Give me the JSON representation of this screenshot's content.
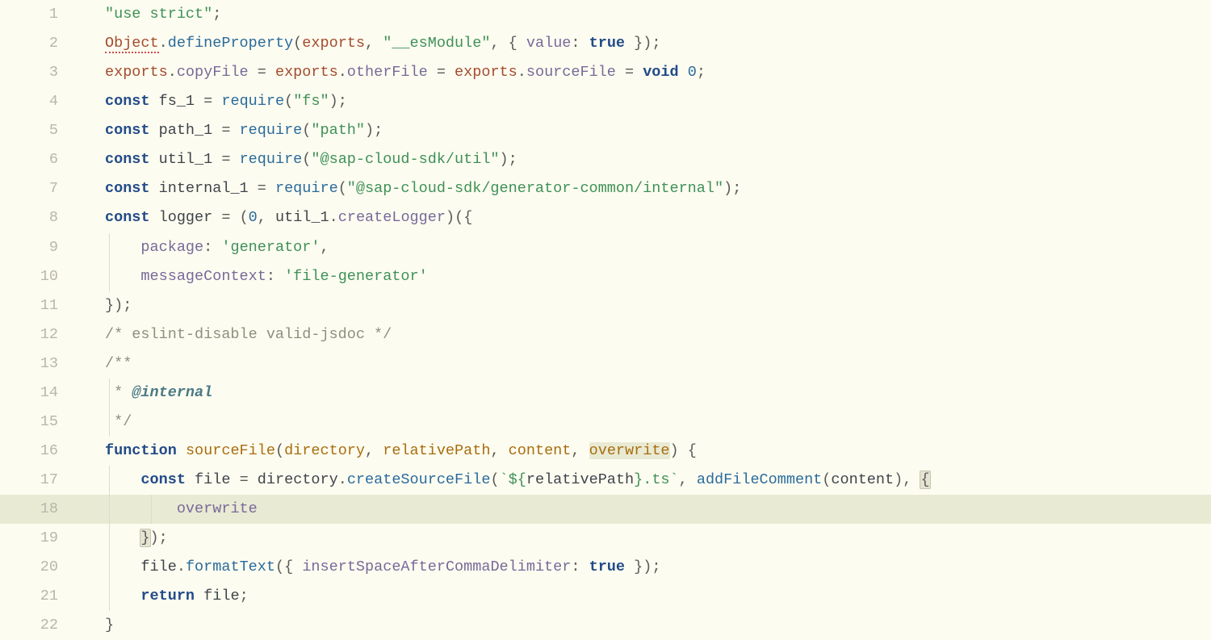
{
  "gutter": [
    "1",
    "2",
    "3",
    "4",
    "5",
    "6",
    "7",
    "8",
    "9",
    "10",
    "11",
    "12",
    "13",
    "14",
    "15",
    "16",
    "17",
    "18",
    "19",
    "20",
    "21",
    "22"
  ],
  "highlighted_line": 18,
  "tokens": {
    "use_strict": "\"use strict\"",
    "semicolon": ";",
    "Object": "Object",
    "dot": ".",
    "defineProperty": "defineProperty",
    "lparen": "(",
    "rparen": ")",
    "exports": "exports",
    "comma_sp": ", ",
    "str_esModule": "\"__esModule\"",
    "lbrace_sp": "{ ",
    "value_key": "value",
    "colon_sp": ": ",
    "true": "true",
    "rbrace_sp": " }",
    "copyFile": "copyFile",
    "eq_sp": " = ",
    "otherFile": "otherFile",
    "sourceFile": "sourceFile",
    "void": "void",
    "zero": "0",
    "const": "const",
    "fs_1": "fs_1",
    "path_1": "path_1",
    "util_1": "util_1",
    "internal_1": "internal_1",
    "logger": "logger",
    "require": "require",
    "str_fs": "\"fs\"",
    "str_path": "\"path\"",
    "str_util": "\"@sap-cloud-sdk/util\"",
    "str_internal": "\"@sap-cloud-sdk/generator-common/internal\"",
    "createLogger": "createLogger",
    "lbrace": "{",
    "rbrace": "}",
    "package_key": "package",
    "str_generator": "'generator'",
    "comma": ",",
    "messageContext_key": "messageContext",
    "str_filegen": "'file-generator'",
    "cmt_eslint": "/* eslint-disable valid-jsdoc */",
    "doc_open": "/**",
    "doc_star": " * ",
    "doc_internal": "@internal",
    "doc_close": " */",
    "function": "function",
    "directory_param": "directory",
    "relativePath_param": "relativePath",
    "content_param": "content",
    "overwrite_param": "overwrite",
    "file": "file",
    "directory_id": "directory",
    "createSourceFile": "createSourceFile",
    "tmpl_open": "`${",
    "relativePath_id": "relativePath",
    "tmpl_ts": "}.ts`",
    "addFileComment": "addFileComment",
    "content_id": "content",
    "overwrite_id": "overwrite",
    "formatText": "formatText",
    "insertSpace_key": "insertSpaceAfterCommaDelimiter",
    "return": "return"
  }
}
